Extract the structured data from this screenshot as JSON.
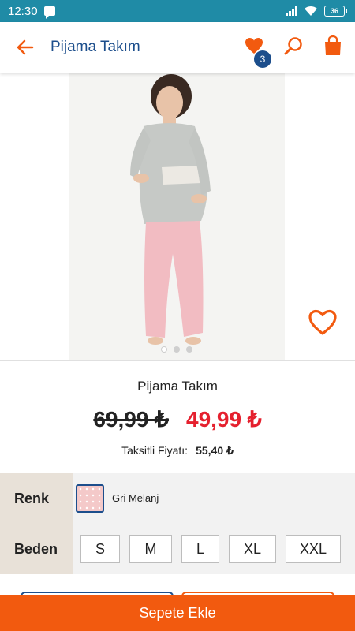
{
  "status_bar": {
    "time": "12:30",
    "battery": "36"
  },
  "app_bar": {
    "title": "Pijama Takım",
    "favorites_count": "3"
  },
  "product": {
    "name": "Pijama Takım",
    "old_price": "69,99 ₺",
    "new_price": "49,99 ₺",
    "installment_label": "Taksitli Fiyatı:",
    "installment_value": "55,40 ₺"
  },
  "options": {
    "color_label": "Renk",
    "color_name": "Gri Melanj",
    "size_label": "Beden",
    "sizes": [
      "S",
      "M",
      "L",
      "XL",
      "XXL"
    ]
  },
  "cta": {
    "label": "Sepete Ekle"
  },
  "colors": {
    "accent": "#f25a0f",
    "brand": "#1c4e8c",
    "sale": "#e5202e",
    "status_bar": "#1f8ba6"
  }
}
